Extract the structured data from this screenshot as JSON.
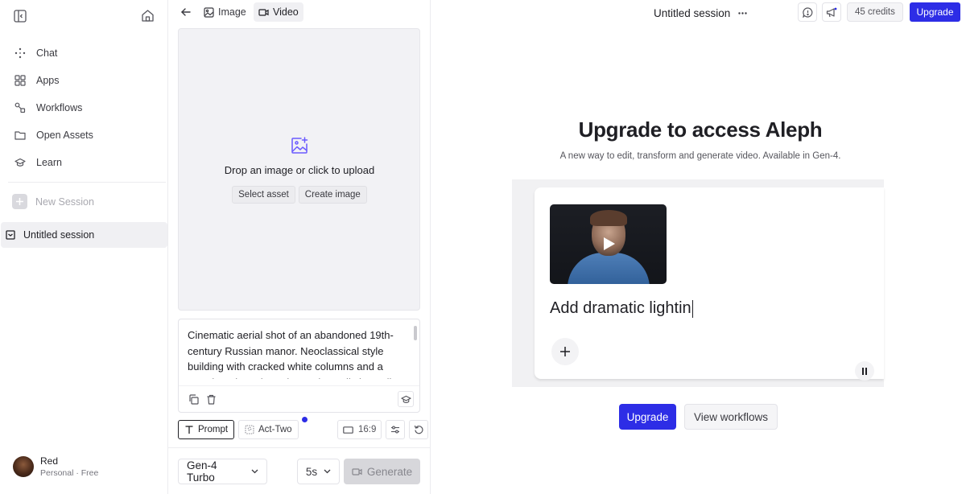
{
  "sidebar": {
    "nav": [
      {
        "label": "Chat",
        "icon": "sparkle-icon"
      },
      {
        "label": "Apps",
        "icon": "grid-icon"
      },
      {
        "label": "Workflows",
        "icon": "workflow-icon"
      },
      {
        "label": "Open Assets",
        "icon": "folder-icon"
      },
      {
        "label": "Learn",
        "icon": "graduation-cap-icon"
      }
    ],
    "new_session": "New Session",
    "session": "Untitled session",
    "user": {
      "name": "Red",
      "plan": "Personal · Free"
    }
  },
  "tool": {
    "tabs": [
      {
        "label": "Image",
        "icon": "image-icon",
        "active": false
      },
      {
        "label": "Video",
        "icon": "video-icon",
        "active": true
      }
    ],
    "upload": {
      "text": "Drop an image or click to upload",
      "select_asset": "Select asset",
      "create_image": "Create image"
    },
    "prompt": "Cinematic aerial shot of an abandoned 19th-century Russian manor. Neoclassical style building with cracked white columns and a grand portico. The paint on the walls is peeling",
    "modes": {
      "prompt": "Prompt",
      "act_two": "Act-Two"
    },
    "aspect_ratio": "16:9",
    "model": "Gen-4 Turbo",
    "duration": "5s",
    "generate": "Generate"
  },
  "main": {
    "session_title": "Untitled session",
    "credits": "45 credits",
    "upgrade_top": "Upgrade",
    "hero_title": "Upgrade to access Aleph",
    "hero_subtitle": "A new way to edit, transform and generate video. Available in Gen-4.",
    "demo_text": "Add dramatic lightin",
    "cta_upgrade": "Upgrade",
    "cta_workflows": "View workflows"
  },
  "colors": {
    "accent": "#2d2de6",
    "icon_accent": "#6b5bff"
  }
}
